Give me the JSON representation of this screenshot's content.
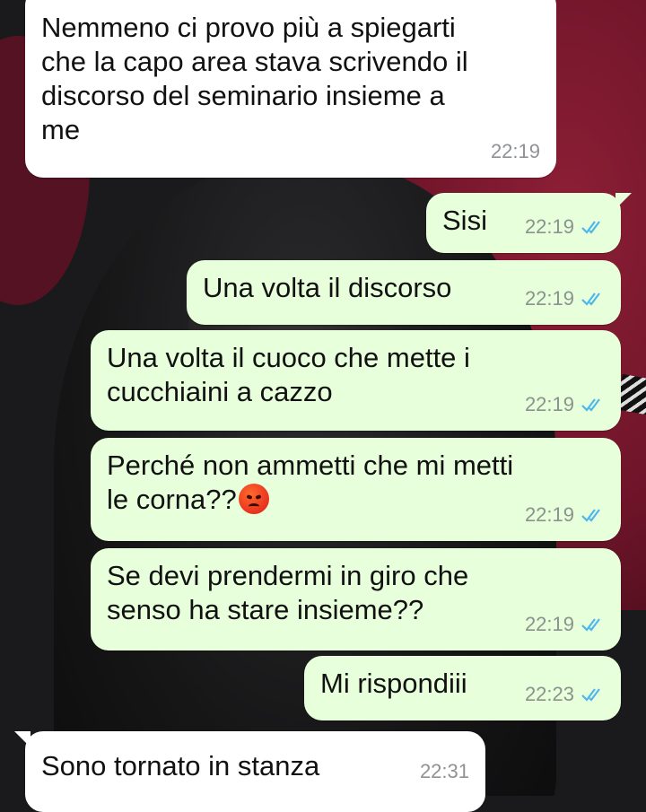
{
  "colors": {
    "incoming_bubble": "#ffffff",
    "outgoing_bubble": "#e7ffdb",
    "read_tick": "#4fb6ec",
    "timestamp": "#8a938c"
  },
  "messages": [
    {
      "direction": "incoming",
      "text": "Nemmeno ci provo più a spiegarti\nche la capo area stava scrivendo il\ndiscorso del seminario insieme a\nme",
      "time": "22:19"
    },
    {
      "direction": "outgoing",
      "text": "Sisi",
      "time": "22:19",
      "status": "read"
    },
    {
      "direction": "outgoing",
      "text": "Una volta il discorso",
      "time": "22:19",
      "status": "read"
    },
    {
      "direction": "outgoing",
      "text": "Una volta il cuoco che mette i\ncucchiaini a cazzo",
      "time": "22:19",
      "status": "read"
    },
    {
      "direction": "outgoing",
      "text": "Perché non ammetti che mi metti\nle corna??",
      "emoji": "angry-face-emoji",
      "time": "22:19",
      "status": "read"
    },
    {
      "direction": "outgoing",
      "text": "Se devi prendermi in giro che\nsenso ha stare insieme??",
      "time": "22:19",
      "status": "read"
    },
    {
      "direction": "outgoing",
      "text": "Mi rispondiii",
      "time": "22:23",
      "status": "read"
    },
    {
      "direction": "incoming",
      "text": "Sono tornato in stanza",
      "time": "22:31"
    }
  ]
}
